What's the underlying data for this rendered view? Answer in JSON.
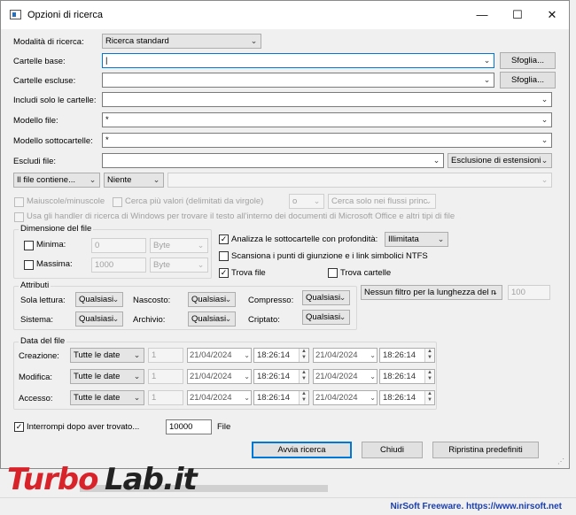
{
  "window": {
    "title": "Opzioni di ricerca",
    "minimize": "—",
    "maximize": "☐",
    "close": "✕"
  },
  "search_mode": {
    "label": "Modalità di ricerca:",
    "value": "Ricerca standard"
  },
  "base_folders": {
    "label": "Cartelle base:",
    "value": "",
    "browse": "Sfoglia..."
  },
  "excluded_folders": {
    "label": "Cartelle escluse:",
    "value": "",
    "browse": "Sfoglia..."
  },
  "include_only_folders": {
    "label": "Includi solo le cartelle:",
    "value": ""
  },
  "file_pattern": {
    "label": "Modello file:",
    "value": "*"
  },
  "subfolder_pattern": {
    "label": "Modello sottocartelle:",
    "value": "*"
  },
  "exclude_files": {
    "label": "Escludi file:",
    "value": "",
    "ext_exclusion": "Esclusione di estensioni"
  },
  "content_filter": {
    "mode": "Il file contiene...",
    "type": "Niente",
    "text": ""
  },
  "options": {
    "case_sensitive": "Maiuscole/minuscole",
    "multi_values": "Cerca più valori (delimitati da virgole)",
    "multi_values_sep": "o",
    "streams": "Cerca solo nei flussi princ",
    "windows_handlers": "Usa gli handler di ricerca di Windows per trovare il testo all'interno dei documenti di Microsoft Office e altri tipi di file"
  },
  "file_size": {
    "title": "Dimensione del file",
    "min_label": "Minima:",
    "min_value": "0",
    "min_unit": "Byte",
    "max_label": "Massima:",
    "max_value": "1000",
    "max_unit": "Byte"
  },
  "subfolders": {
    "scan_label": "Analizza le sottocartelle con profondità:",
    "depth": "Illimitata",
    "junctions": "Scansiona i punti di giunzione e i link simbolici NTFS",
    "find_files": "Trova file",
    "find_folders": "Trova cartelle"
  },
  "attributes": {
    "title": "Attributi",
    "readonly": "Sola lettura:",
    "hidden": "Nascosto:",
    "compressed": "Compresso:",
    "system": "Sistema:",
    "archive": "Archivio:",
    "encrypted": "Criptato:",
    "any": "Qualsiasi"
  },
  "name_length": {
    "value": "Nessun filtro per la lunghezza del n",
    "number": "100"
  },
  "file_date": {
    "title": "Data del file",
    "rows": [
      {
        "label": "Creazione:",
        "mode": "Tutte le date",
        "n": "1",
        "date1": "21/04/2024",
        "time1": "18:26:14",
        "date2": "21/04/2024",
        "time2": "18:26:14"
      },
      {
        "label": "Modifica:",
        "mode": "Tutte le date",
        "n": "1",
        "date1": "21/04/2024",
        "time1": "18:26:14",
        "date2": "21/04/2024",
        "time2": "18:26:14"
      },
      {
        "label": "Accesso:",
        "mode": "Tutte le date",
        "n": "1",
        "date1": "21/04/2024",
        "time1": "18:26:14",
        "date2": "21/04/2024",
        "time2": "18:26:14"
      }
    ]
  },
  "stop_after": {
    "label": "Interrompi dopo aver trovato...",
    "value": "10000",
    "unit": "File"
  },
  "buttons": {
    "start": "Avvia ricerca",
    "close": "Chiudi",
    "reset": "Ripristina predefiniti"
  },
  "watermark": {
    "part1": "Turbo",
    "part2": "Lab.it"
  },
  "status": {
    "text": "NirSoft Freeware. https://www.nirsoft.net"
  },
  "colors": {
    "focus": "#0078d7",
    "link": "#1a3fb0",
    "logo_red": "#d9232a"
  }
}
